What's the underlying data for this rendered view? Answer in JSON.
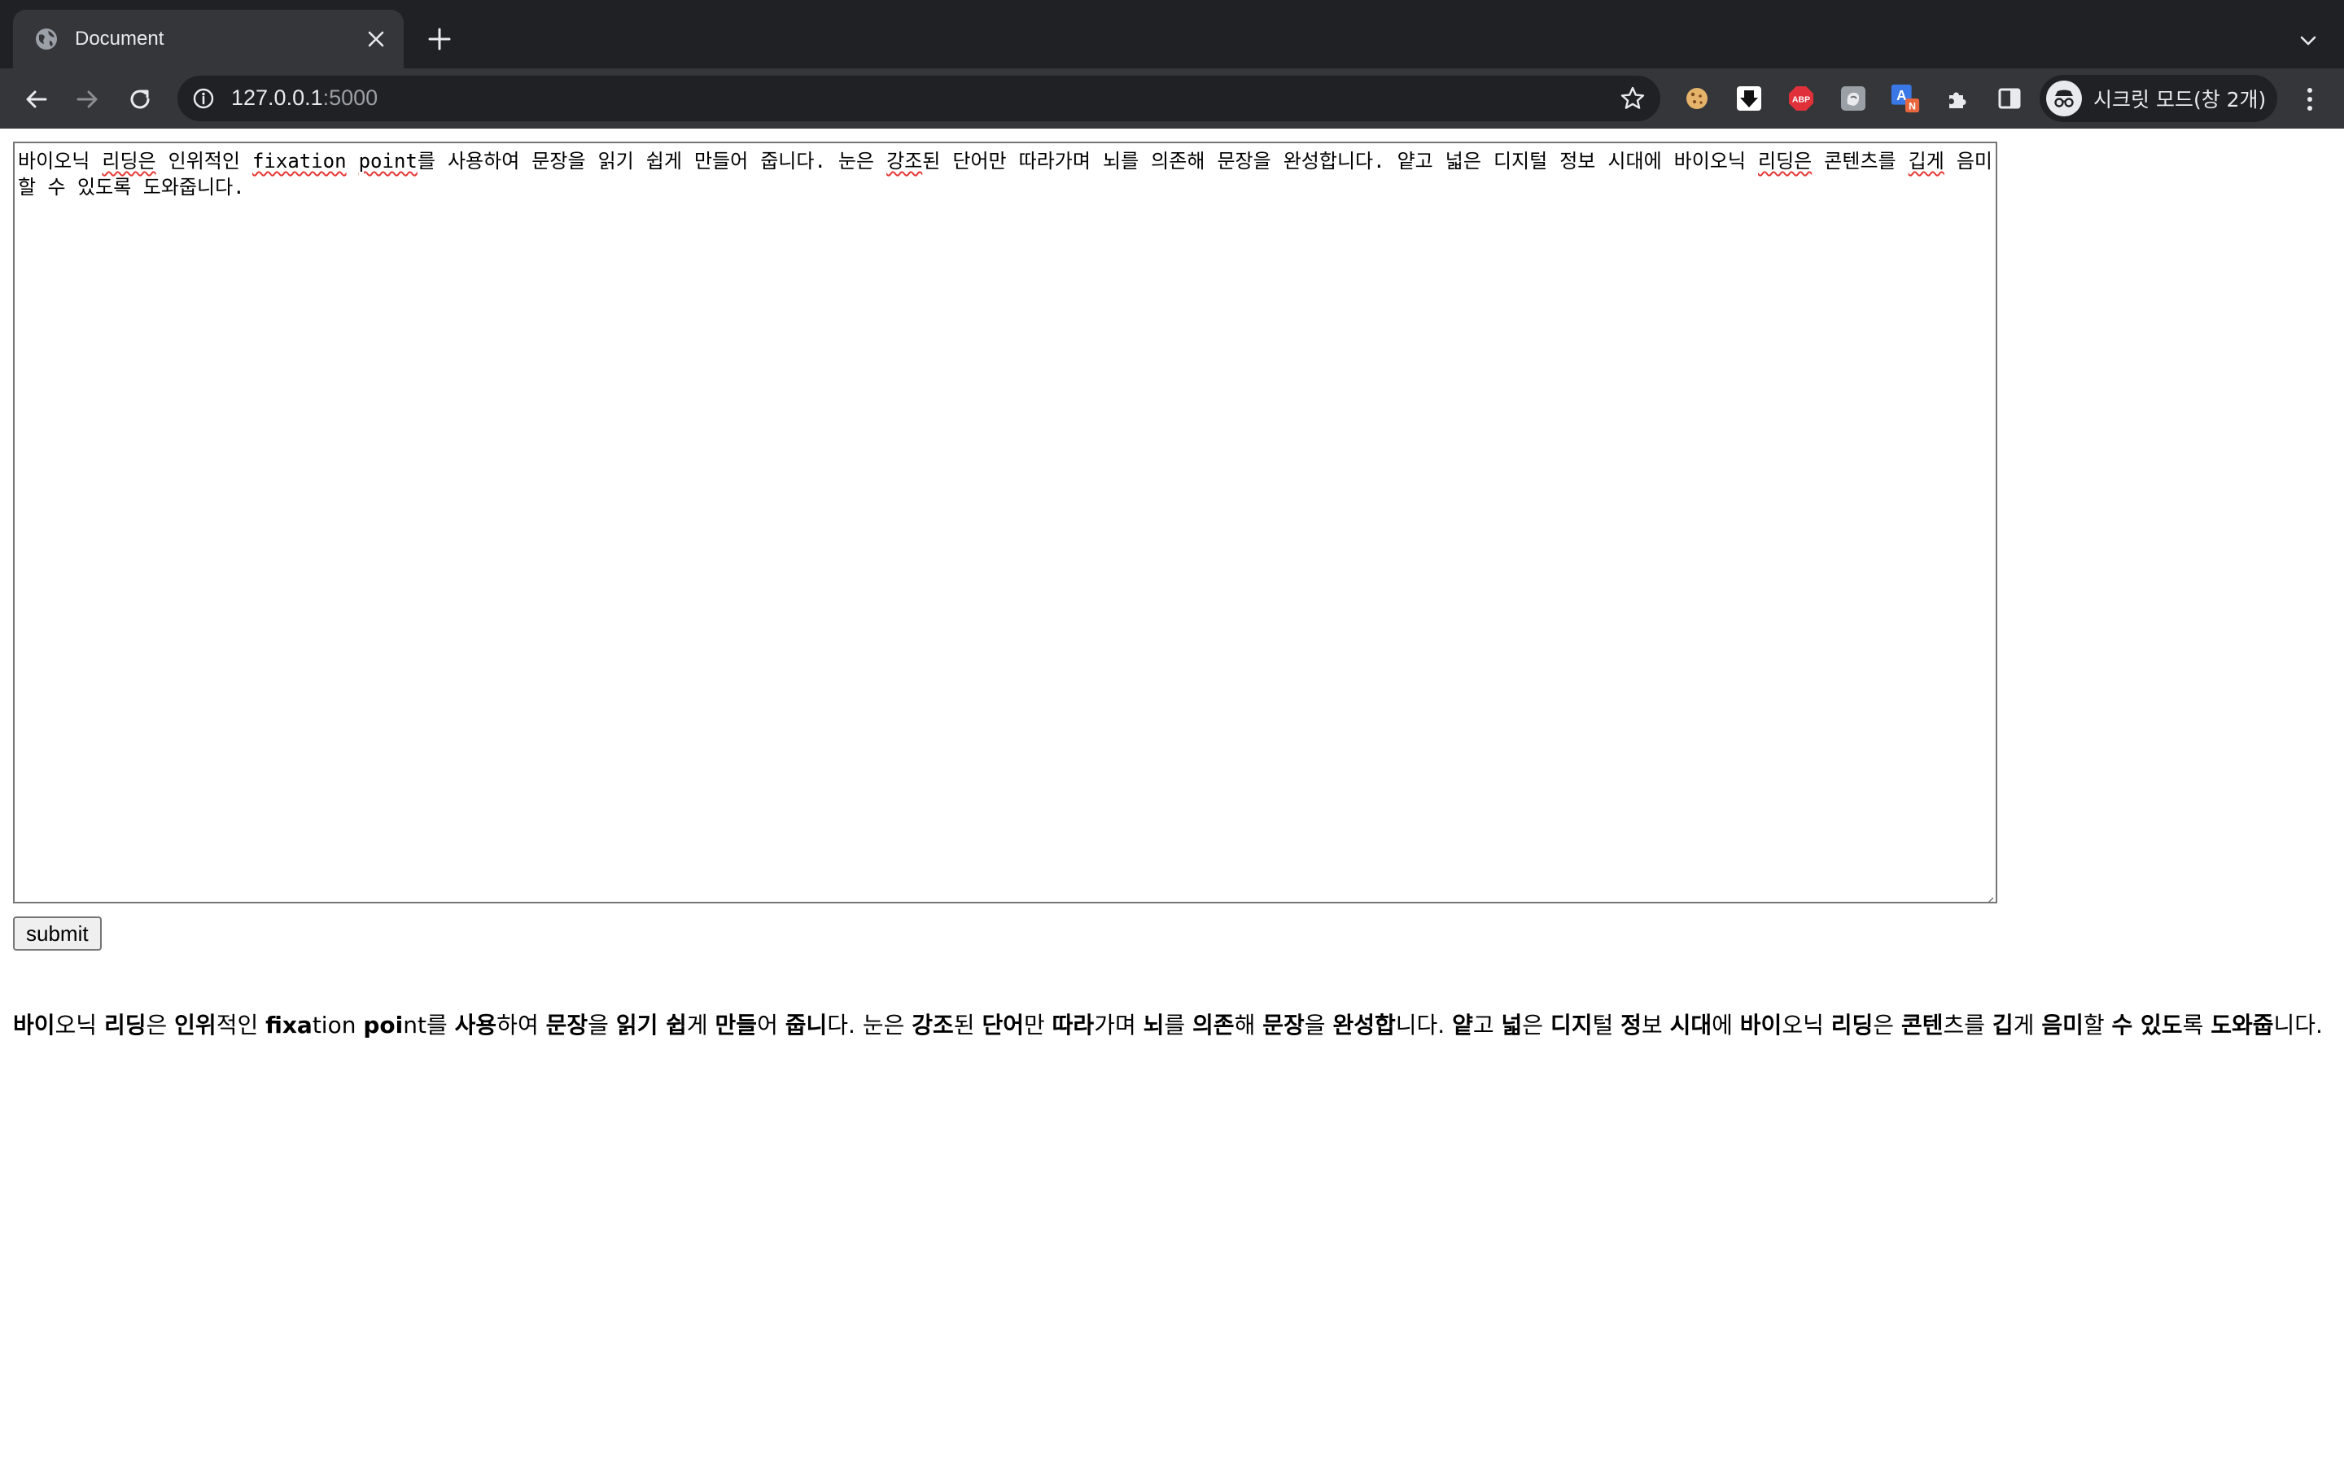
{
  "browser": {
    "tab_title": "Document",
    "url_host": "127.0.0.1",
    "url_port": ":5000",
    "incognito_label": "시크릿 모드(창 2개)",
    "extensions": [
      "cookie-icon",
      "download-icon",
      "adblock-icon",
      "ext-gray-icon",
      "translate-icon",
      "puzzle-icon"
    ],
    "adblock_label": "ABP",
    "translate_badge": "N"
  },
  "editor": {
    "segments": [
      {
        "t": "바이오닉 ",
        "spell": false
      },
      {
        "t": "리딩은",
        "spell": true
      },
      {
        "t": " 인위적인 ",
        "spell": false
      },
      {
        "t": "fixation",
        "spell": true
      },
      {
        "t": " ",
        "spell": false
      },
      {
        "t": "point",
        "spell": true
      },
      {
        "t": "를 사용하여 문장을 읽기 쉽게 만들어 줍니다. 눈은 ",
        "spell": false
      },
      {
        "t": "강조",
        "spell": true
      },
      {
        "t": "된 단어만 따라가며 뇌를 의존해 문장을 완성합니다. 얕고 넓은 디지털 정보 시대에 바이오닉 ",
        "spell": false
      },
      {
        "t": "리딩은",
        "spell": true
      },
      {
        "t": " 콘텐츠를 ",
        "spell": false
      },
      {
        "t": "깁게",
        "spell": true
      },
      {
        "t": " 음미할 수 있도록 도와줍니다.",
        "spell": false
      }
    ]
  },
  "submit_label": "submit",
  "output": [
    {
      "t": "바이",
      "b": true
    },
    {
      "t": "오닉 ",
      "b": false
    },
    {
      "t": "리딩",
      "b": true
    },
    {
      "t": "은 ",
      "b": false
    },
    {
      "t": "인위",
      "b": true
    },
    {
      "t": "적인 ",
      "b": false
    },
    {
      "t": "fixa",
      "b": true
    },
    {
      "t": "tion ",
      "b": false
    },
    {
      "t": "poi",
      "b": true
    },
    {
      "t": "nt를 ",
      "b": false
    },
    {
      "t": "사용",
      "b": true
    },
    {
      "t": "하여 ",
      "b": false
    },
    {
      "t": "문장",
      "b": true
    },
    {
      "t": "을 ",
      "b": false
    },
    {
      "t": "읽기 ",
      "b": true
    },
    {
      "t": "쉽",
      "b": true
    },
    {
      "t": "게 ",
      "b": false
    },
    {
      "t": "만들",
      "b": true
    },
    {
      "t": "어 ",
      "b": false
    },
    {
      "t": "줍니",
      "b": true
    },
    {
      "t": "다. 눈은 ",
      "b": false
    },
    {
      "t": "강조",
      "b": true
    },
    {
      "t": "된 ",
      "b": false
    },
    {
      "t": "단어",
      "b": true
    },
    {
      "t": "만 ",
      "b": false
    },
    {
      "t": "따라",
      "b": true
    },
    {
      "t": "가며 ",
      "b": false
    },
    {
      "t": "뇌",
      "b": true
    },
    {
      "t": "를 ",
      "b": false
    },
    {
      "t": "의존",
      "b": true
    },
    {
      "t": "해 ",
      "b": false
    },
    {
      "t": "문장",
      "b": true
    },
    {
      "t": "을 ",
      "b": false
    },
    {
      "t": "완성합",
      "b": true
    },
    {
      "t": "니다. ",
      "b": false
    },
    {
      "t": "얕",
      "b": true
    },
    {
      "t": "고 ",
      "b": false
    },
    {
      "t": "넓",
      "b": true
    },
    {
      "t": "은 ",
      "b": false
    },
    {
      "t": "디지",
      "b": true
    },
    {
      "t": "털 ",
      "b": false
    },
    {
      "t": "정",
      "b": true
    },
    {
      "t": "보 ",
      "b": false
    },
    {
      "t": "시대",
      "b": true
    },
    {
      "t": "에 ",
      "b": false
    },
    {
      "t": "바이",
      "b": true
    },
    {
      "t": "오닉 ",
      "b": false
    },
    {
      "t": "리딩",
      "b": true
    },
    {
      "t": "은 ",
      "b": false
    },
    {
      "t": "콘텐",
      "b": true
    },
    {
      "t": "츠를 ",
      "b": false
    },
    {
      "t": "깁",
      "b": true
    },
    {
      "t": "게 ",
      "b": false
    },
    {
      "t": "음미",
      "b": true
    },
    {
      "t": "할 ",
      "b": false
    },
    {
      "t": "수 있도",
      "b": true
    },
    {
      "t": "록 ",
      "b": false
    },
    {
      "t": "도와줍",
      "b": true
    },
    {
      "t": "니다.",
      "b": false
    }
  ],
  "colors": {
    "tabstrip_bg": "#202124",
    "toolbar_bg": "#35363a",
    "spellcheck": "#e53935",
    "adblock_red": "#e0303a",
    "translate_blue": "#3b78e7",
    "translate_badge": "#e8663d"
  }
}
